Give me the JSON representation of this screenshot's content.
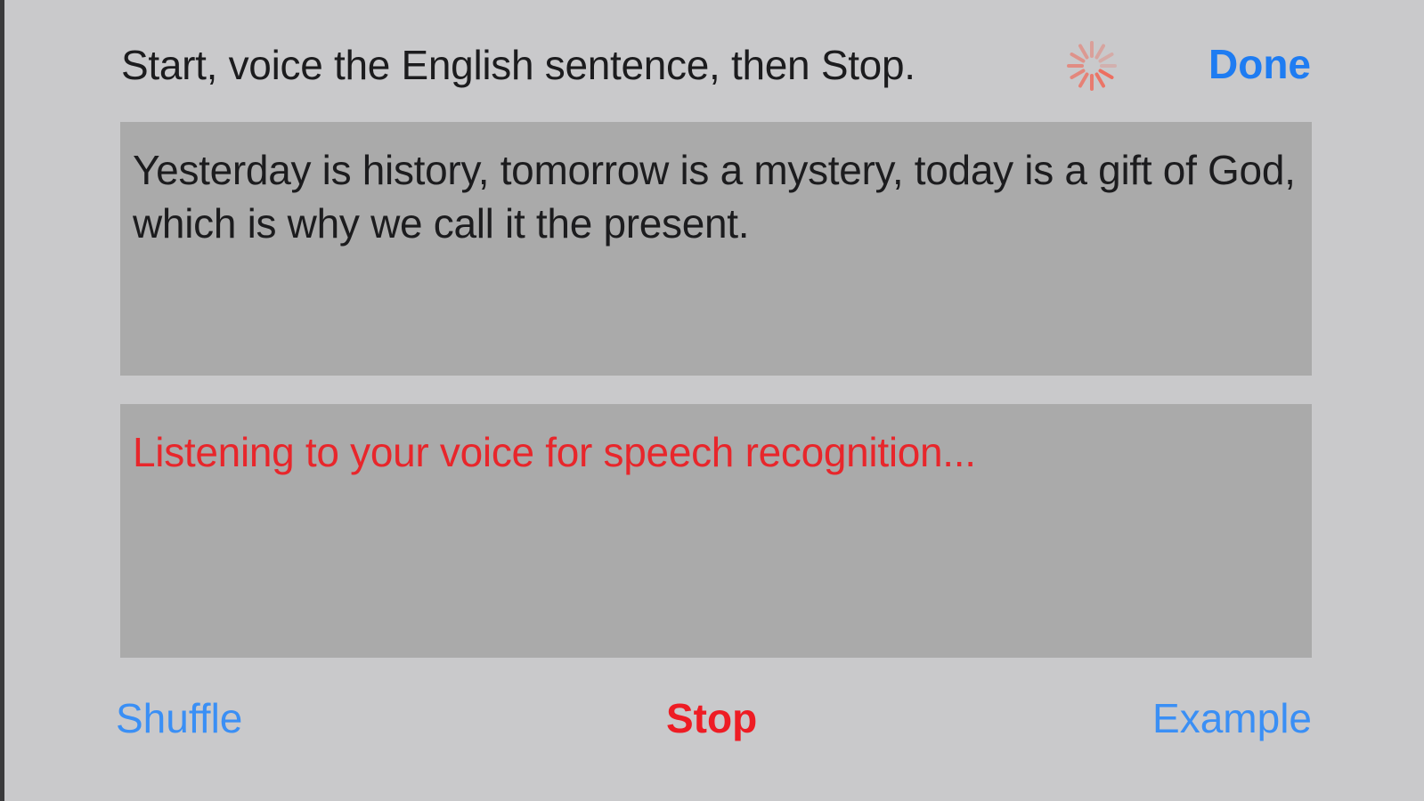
{
  "header": {
    "instruction": "Start, voice the English sentence, then Stop.",
    "done_label": "Done",
    "spinner_icon": "activity-spinner-icon",
    "spinner_color": "#f06a5a"
  },
  "sentence": {
    "text": "Yesterday is history, tomorrow is a mystery, today is a gift of God, which is why we call it the present."
  },
  "recognition": {
    "status_text": "Listening to your voice for speech recognition...",
    "status_color": "#e8262b"
  },
  "footer": {
    "shuffle_label": "Shuffle",
    "stop_label": "Stop",
    "example_label": "Example"
  },
  "colors": {
    "accent": "#1e7cf2",
    "stop": "#ee1c24",
    "background": "#c9c9cb",
    "box": "#aaaaaa"
  }
}
